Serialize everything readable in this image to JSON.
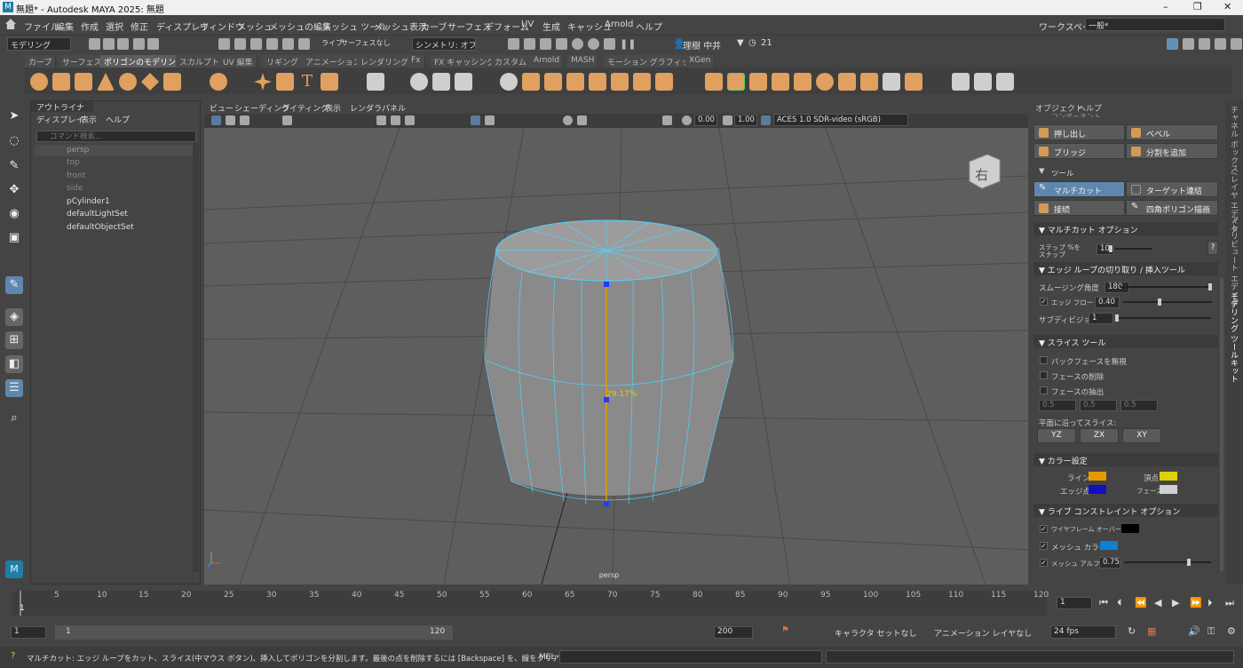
{
  "window": {
    "title": "無題* - Autodesk MAYA 2025: 無題",
    "min": "–",
    "max": "❐",
    "close": "✕"
  },
  "menu": [
    "ファイル",
    "編集",
    "作成",
    "選択",
    "修正",
    "ディスプレイ",
    "ウィンドウ",
    "メッシュ",
    "メッシュの編集",
    "メッシュ ツール",
    "メッシュ表示",
    "カーブ",
    "サーフェス",
    "デフォーム",
    "UV",
    "生成",
    "キャッシュ",
    "Arnold",
    "ヘルプ"
  ],
  "workspace": {
    "label": "ワークスペース:",
    "value": "一般*"
  },
  "toolbar": {
    "mode": "モデリング",
    "live": "ライブ",
    "live_value": "サーフェスなし",
    "symmetry": "シンメトリ: オフ",
    "user": "理樹 中井",
    "credits": "21"
  },
  "shelf_tabs": [
    "カーブ",
    "サーフェス",
    "ポリゴンのモデリング",
    "スカルプト",
    "UV 編集",
    "リギング",
    "アニメーション",
    "レンダリング",
    "Fx",
    "FX キャッシング",
    "カスタム",
    "Arnold",
    "MASH",
    "モーション グラフィックス",
    "XGen"
  ],
  "outliner": {
    "title": "アウトライナ",
    "menus": [
      "ディスプレイ",
      "表示",
      "ヘルプ"
    ],
    "search_placeholder": "コマンド検索...",
    "items": [
      "persp",
      "top",
      "front",
      "side",
      "pCylinder1",
      "defaultLightSet",
      "defaultObjectSet"
    ]
  },
  "viewport": {
    "menus": [
      "ビュー",
      "シェーディング",
      "ライティング",
      "表示",
      "レンダラ",
      "パネル"
    ],
    "exposure": "0.00",
    "gamma": "1.00",
    "colorspace": "ACES 1.0 SDR-video (sRGB)",
    "camera_label": "persp",
    "viewcube_label": "右",
    "percent_label": "29.17%"
  },
  "modeling_toolkit": {
    "menus": [
      "オブジェクト",
      "ヘルプ"
    ],
    "components_header": "コンポーネント",
    "comp_buttons": [
      "押し出し",
      "ベベル",
      "ブリッジ",
      "分割を追加"
    ],
    "tools_header": "ツール",
    "tool_buttons": [
      "マルチカット",
      "ターゲット連結",
      "接続",
      "四角ポリゴン描画"
    ],
    "multicut_header": "マルチカット オプション",
    "step_label": "ステップ %を スナップ",
    "step_value": "10",
    "help": "?",
    "edgeloop_header": "エッジ ループの切り取り / 挿入ツール",
    "smoothing_label": "スムージング角度",
    "smoothing_value": "180",
    "edgeflow_label": "エッジ フロー",
    "edgeflow_value": "0.40",
    "subdiv_label": "サブディビジョン",
    "subdiv_value": "1",
    "slice_header": "スライス ツール",
    "slice_opts": [
      "バックフェースを無視",
      "フェースの削除",
      "フェースの抽出"
    ],
    "slice_vals": [
      "0.5",
      "0.5",
      "0.5"
    ],
    "plane_label": "平面に沿ってスライス:",
    "plane_buttons": [
      "YZ",
      "ZX",
      "XY"
    ],
    "color_header": "カラー設定",
    "color_line": "ライン",
    "color_vertex": "頂点",
    "color_edgept": "エッジ点",
    "color_facept": "フェース点",
    "colors": {
      "line": "#e69a00",
      "vertex": "#e0d000",
      "edgept": "#1010c0",
      "facept": "#d0d0d0",
      "wire": "#000000",
      "mesh": "#1080d0"
    },
    "live_header": "ライブ コンストレイント オプション",
    "wire_label": "ワイヤフレーム オーバーレイ",
    "meshcolor_label": "メッシュ カラー",
    "alpha_label": "メッシュ アルファ値",
    "alpha_value": "0.75",
    "check": "✓"
  },
  "side_tabs": [
    "チャネル ボックス/レイヤ エディタ",
    "アトリビュート エディタ",
    "モデリング ツールキット"
  ],
  "timeline": {
    "ticks": [
      "5",
      "10",
      "15",
      "20",
      "25",
      "30",
      "35",
      "40",
      "45",
      "50",
      "55",
      "60",
      "65",
      "70",
      "75",
      "80",
      "85",
      "90",
      "95",
      "100",
      "105",
      "110",
      "115",
      "120"
    ],
    "frame_start_tick": "1",
    "current": "1"
  },
  "range": {
    "start": "1",
    "inner_start": "1",
    "inner_end": "120",
    "end": "200",
    "character": "キャラクタ セットなし",
    "anim_layer": "アニメーション レイヤなし",
    "fps": "24 fps"
  },
  "status": {
    "help": "マルチカット: エッジ ループをカット、スライス(中マウス ボタン)、挿入してポリゴンを分割します。最後の点を削除するには [Backspace] を、線をクリアするには [Esc] を押します。",
    "mel": "MEL"
  }
}
